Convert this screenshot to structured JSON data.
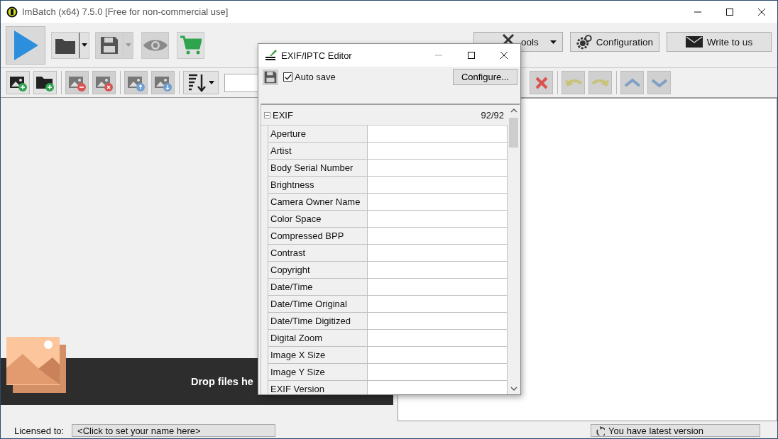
{
  "window": {
    "title": "ImBatch (x64) 7.5.0 [Free for non-commercial use]"
  },
  "toolbar": {
    "tools_button": "ools",
    "configuration_button": "Configuration",
    "write_button": "Write to us"
  },
  "drop_zone": {
    "text": "Drop files he"
  },
  "status_bar": {
    "license_label": "Licensed to:",
    "license_field": "<Click to set your name here>",
    "version": "You have latest version"
  },
  "dialog": {
    "title": "EXIF/IPTC Editor",
    "auto_save": {
      "label": "Auto save",
      "checked": true
    },
    "configure_button": "Configure...",
    "group": {
      "name": "EXIF",
      "expanded": true,
      "count": "92/92",
      "rows": [
        {
          "name": "Aperture"
        },
        {
          "name": "Artist"
        },
        {
          "name": "Body Serial Number"
        },
        {
          "name": "Brightness"
        },
        {
          "name": "Camera Owner Name"
        },
        {
          "name": "Color Space"
        },
        {
          "name": "Compressed BPP"
        },
        {
          "name": "Contrast"
        },
        {
          "name": "Copyright"
        },
        {
          "name": "Date/Time"
        },
        {
          "name": "Date/Time Original"
        },
        {
          "name": "Date/Time Digitized"
        },
        {
          "name": "Digital Zoom"
        },
        {
          "name": "Image X Size"
        },
        {
          "name": "Image Y Size"
        },
        {
          "name": "EXIF Version"
        }
      ]
    }
  }
}
